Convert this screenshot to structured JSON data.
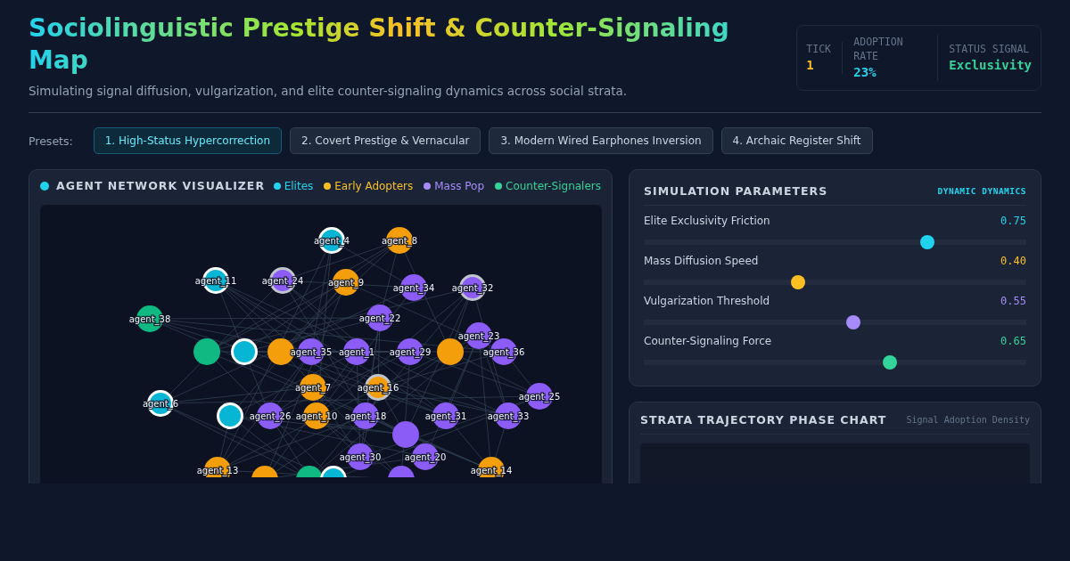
{
  "header": {
    "title": "Sociolinguistic Prestige Shift & Counter-Signaling Map",
    "subtitle": "Simulating signal diffusion, vulgarization, and elite counter-signaling dynamics across social strata.",
    "stats": [
      {
        "label": "TICK",
        "value": "1",
        "color": "#fbbf24"
      },
      {
        "label": "ADOPTION RATE",
        "value": "23%",
        "color": "#22d3ee"
      },
      {
        "label": "STATUS SIGNAL",
        "value": "Exclusivity",
        "color": "#34d399"
      }
    ]
  },
  "presets": {
    "label": "Presets:",
    "items": [
      {
        "label": "1. High-Status Hypercorrection",
        "selected": true
      },
      {
        "label": "2. Covert Prestige & Vernacular",
        "selected": false
      },
      {
        "label": "3. Modern Wired Earphones Inversion",
        "selected": false
      },
      {
        "label": "4. Archaic Register Shift",
        "selected": false
      }
    ]
  },
  "network": {
    "title": "AGENT NETWORK VISUALIZER",
    "legend": [
      {
        "label": "Elites",
        "color": "#22d3ee"
      },
      {
        "label": "Early Adopters",
        "color": "#fbbf24"
      },
      {
        "label": "Mass Pop",
        "color": "#a78bfa"
      },
      {
        "label": "Counter-Signalers",
        "color": "#34d399"
      }
    ],
    "nodes": [
      {
        "label": "agent_4",
        "kind": "elite",
        "marked": false
      },
      {
        "label": "agent_8",
        "kind": "early",
        "marked": false
      },
      {
        "label": "agent_11",
        "kind": "elite",
        "marked": false
      },
      {
        "label": "agent_24",
        "kind": "mass",
        "marked": true
      },
      {
        "label": "agent_9",
        "kind": "early",
        "marked": false
      },
      {
        "label": "agent_34",
        "kind": "mass",
        "marked": false
      },
      {
        "label": "agent_32",
        "kind": "mass",
        "marked": true
      },
      {
        "label": "agent_38",
        "kind": "counter",
        "marked": false
      },
      {
        "label": "agent_22",
        "kind": "mass",
        "marked": false
      },
      {
        "label": "agent_23",
        "kind": "mass",
        "marked": false
      },
      {
        "kind": "counter",
        "marked": false
      },
      {
        "kind": "elite",
        "marked": false
      },
      {
        "kind": "early",
        "marked": false
      },
      {
        "label": "agent_35",
        "kind": "mass",
        "marked": false
      },
      {
        "label": "agent_1",
        "kind": "mass",
        "marked": false
      },
      {
        "label": "agent_29",
        "kind": "mass",
        "marked": false
      },
      {
        "kind": "early",
        "marked": false
      },
      {
        "label": "agent_36",
        "kind": "mass",
        "marked": false
      },
      {
        "label": "agent_7",
        "kind": "early",
        "marked": false
      },
      {
        "label": "agent_16",
        "kind": "early",
        "marked": true
      },
      {
        "label": "agent_6",
        "kind": "elite",
        "marked": false
      },
      {
        "kind": "elite",
        "marked": false
      },
      {
        "label": "agent_26",
        "kind": "mass",
        "marked": false
      },
      {
        "label": "agent_10",
        "kind": "early",
        "marked": false
      },
      {
        "label": "agent_18",
        "kind": "mass",
        "marked": false
      },
      {
        "kind": "mass",
        "marked": false
      },
      {
        "label": "agent_31",
        "kind": "mass",
        "marked": false
      },
      {
        "label": "agent_33",
        "kind": "mass",
        "marked": false
      },
      {
        "label": "agent_25",
        "kind": "mass",
        "marked": false
      },
      {
        "label": "agent_30",
        "kind": "mass",
        "marked": false
      },
      {
        "label": "agent_20",
        "kind": "mass",
        "marked": false
      },
      {
        "label": "agent_13",
        "kind": "early",
        "marked": false
      },
      {
        "label": "agent_14",
        "kind": "early",
        "marked": false
      },
      {
        "kind": "early",
        "marked": false
      },
      {
        "kind": "counter",
        "marked": false
      },
      {
        "kind": "elite",
        "marked": false
      },
      {
        "kind": "mass",
        "marked": false
      }
    ]
  },
  "parameters": {
    "title": "SIMULATION PARAMETERS",
    "tag": "DYNAMIC DYNAMICS",
    "sliders": [
      {
        "label": "Elite Exclusivity Friction",
        "reading": "0.75",
        "level": 0.75,
        "color": "#22d3ee"
      },
      {
        "label": "Mass Diffusion Speed",
        "reading": "0.40",
        "level": 0.4,
        "color": "#fbbf24"
      },
      {
        "label": "Vulgarization Threshold",
        "reading": "0.55",
        "level": 0.55,
        "color": "#a78bfa"
      },
      {
        "label": "Counter-Signaling Force",
        "reading": "0.65",
        "level": 0.65,
        "color": "#34d399"
      }
    ]
  },
  "phase_chart": {
    "title": "STRATA TRAJECTORY PHASE CHART",
    "subtitle": "Signal Adoption Density"
  }
}
